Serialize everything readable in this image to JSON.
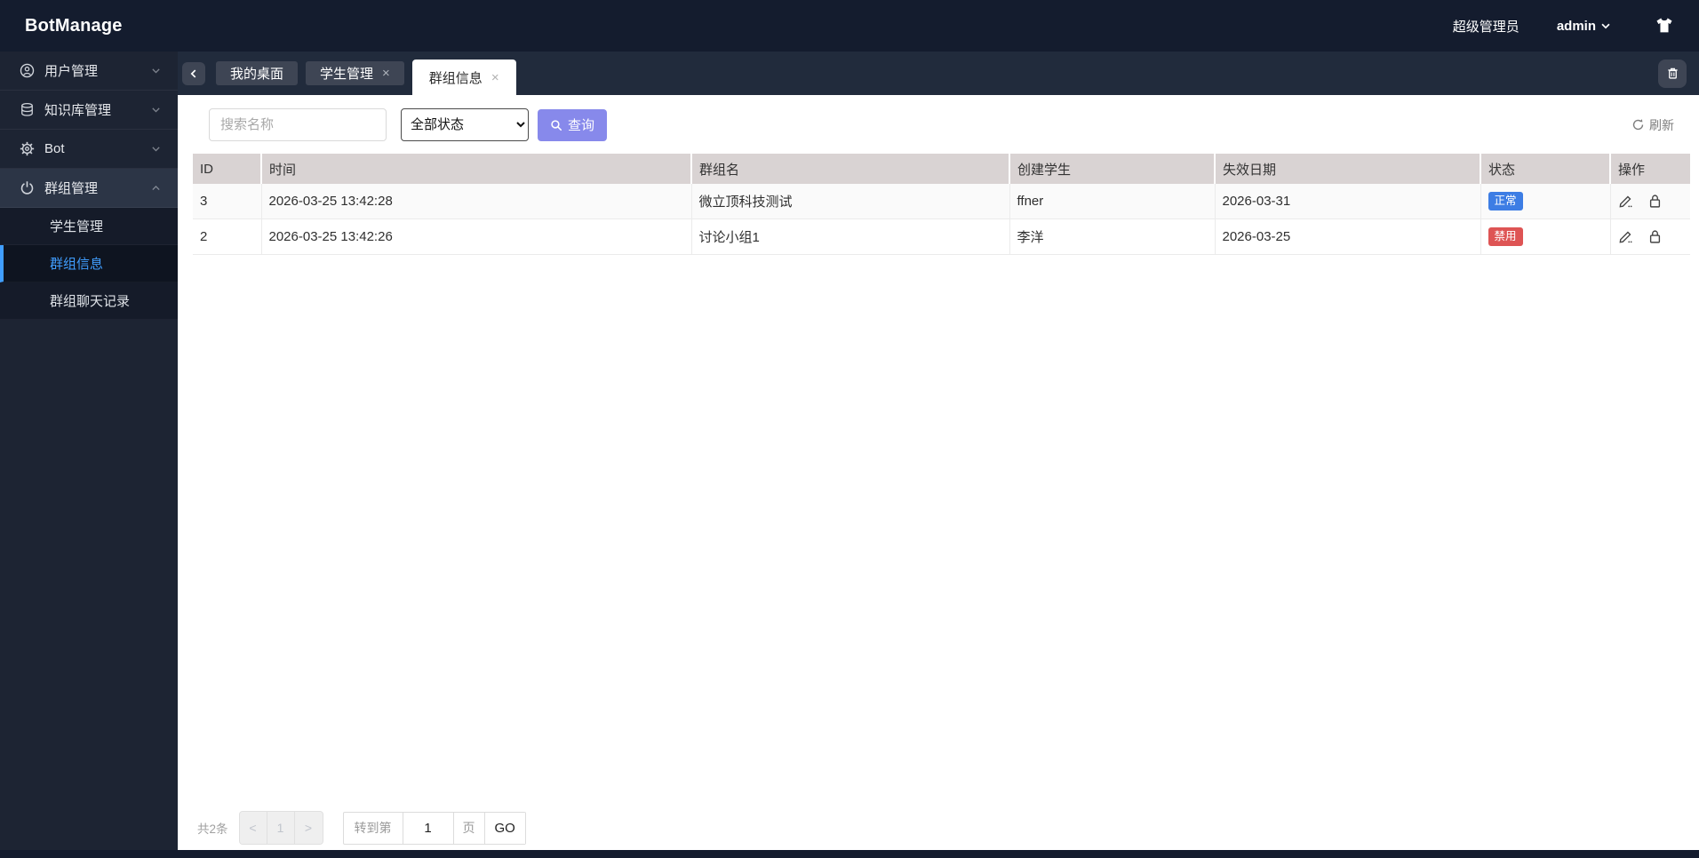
{
  "topbar": {
    "brand": "BotManage",
    "role": "超级管理员",
    "user": "admin"
  },
  "sidebar": {
    "items": [
      {
        "label": "用户管理"
      },
      {
        "label": "知识库管理"
      },
      {
        "label": "Bot"
      },
      {
        "label": "群组管理",
        "children": [
          {
            "label": "学生管理"
          },
          {
            "label": "群组信息"
          },
          {
            "label": "群组聊天记录"
          }
        ]
      }
    ]
  },
  "tabbar": {
    "tabs": [
      {
        "label": "我的桌面"
      },
      {
        "label": "学生管理"
      },
      {
        "label": "群组信息"
      }
    ],
    "close_glyph": "×"
  },
  "toolbar": {
    "search_placeholder": "搜索名称",
    "status_filter": "全部状态",
    "query": "查询",
    "refresh": "刷新"
  },
  "table": {
    "columns": [
      "ID",
      "时间",
      "群组名",
      "创建学生",
      "失效日期",
      "状态",
      "操作"
    ],
    "rows": [
      {
        "id": "3",
        "time": "2026-03-25 13:42:28",
        "group": "微立顶科技测试",
        "creator": "ffner",
        "expire": "2026-03-31",
        "status": "正常"
      },
      {
        "id": "2",
        "time": "2026-03-25 13:42:26",
        "group": "讨论小组1",
        "creator": "李洋",
        "expire": "2026-03-25",
        "status": "禁用"
      }
    ]
  },
  "pagination": {
    "total": "共2条",
    "prev": "<",
    "page": "1",
    "next": ">",
    "goto_prefix": "转到第",
    "goto_value": "1",
    "goto_suffix": "页",
    "go": "GO"
  },
  "colors": {
    "accent": "#409eff",
    "badge_normal": "#3d7de4",
    "badge_disabled": "#de5454",
    "query_button": "#8789eb",
    "header_bg": "#d9d3d3",
    "topbar_bg": "#141c2e",
    "sidebar_bg": "#1d2433"
  }
}
